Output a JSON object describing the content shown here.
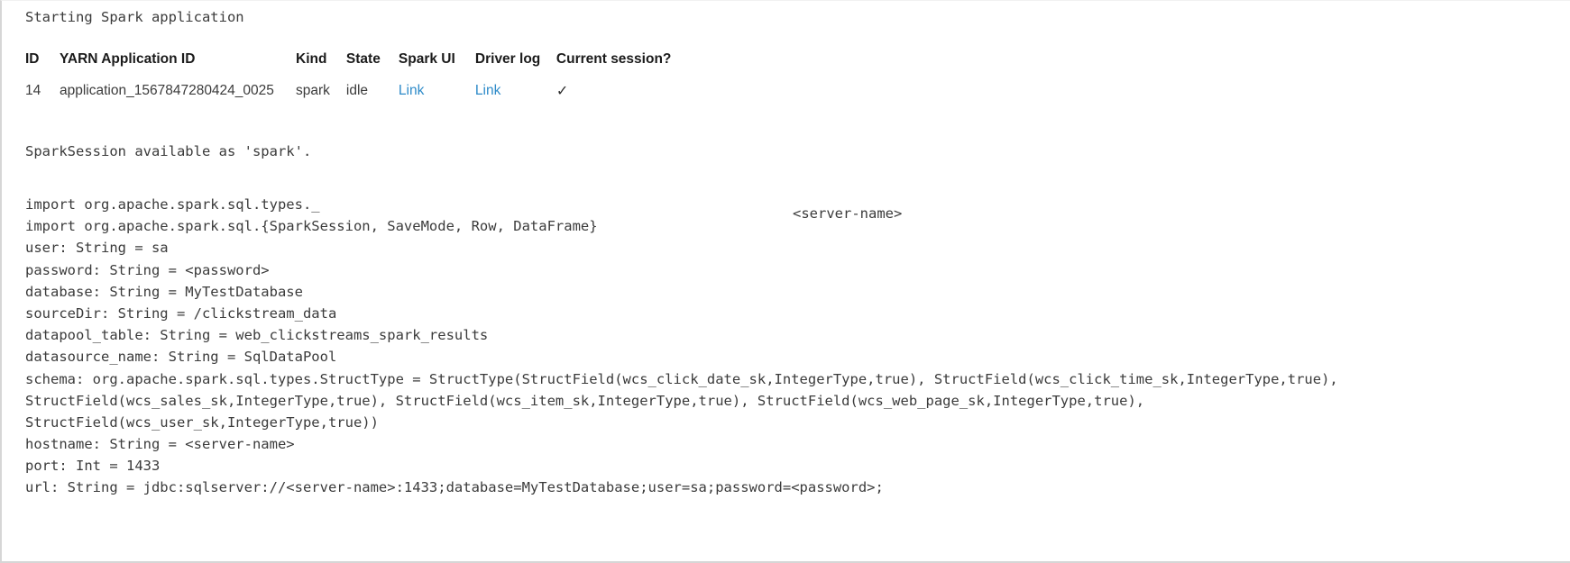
{
  "cell": {
    "status_line": "Starting Spark application"
  },
  "session_table": {
    "columns": [
      {
        "key": "id",
        "label": "ID"
      },
      {
        "key": "appid",
        "label": "YARN Application ID"
      },
      {
        "key": "kind",
        "label": "Kind"
      },
      {
        "key": "state",
        "label": "State"
      },
      {
        "key": "spark_ui",
        "label": "Spark UI"
      },
      {
        "key": "driver_log",
        "label": "Driver log"
      },
      {
        "key": "current",
        "label": "Current session?"
      }
    ],
    "rows": [
      {
        "id": "14",
        "appid": "application_1567847280424_0025",
        "kind": "spark",
        "state": "idle",
        "spark_ui": "Link",
        "driver_log": "Link",
        "current": "✓"
      }
    ],
    "link_color": "#2e8bc9"
  },
  "session_message": "SparkSession available as 'spark'.",
  "floating_annotation": "<server-name>",
  "repl_output": {
    "lines": [
      "import org.apache.spark.sql.types._",
      "import org.apache.spark.sql.{SparkSession, SaveMode, Row, DataFrame}",
      "user: String = sa",
      "password: String = <password>",
      "database: String = MyTestDatabase",
      "sourceDir: String = /clickstream_data",
      "datapool_table: String = web_clickstreams_spark_results",
      "datasource_name: String = SqlDataPool",
      "schema: org.apache.spark.sql.types.StructType = StructType(StructField(wcs_click_date_sk,IntegerType,true), StructField(wcs_click_time_sk,IntegerType,true),",
      "StructField(wcs_sales_sk,IntegerType,true), StructField(wcs_item_sk,IntegerType,true), StructField(wcs_web_page_sk,IntegerType,true),",
      "StructField(wcs_user_sk,IntegerType,true))",
      "hostname: String = <server-name>",
      "port: Int = 1433",
      "url: String = jdbc:sqlserver://<server-name>:1433;database=MyTestDatabase;user=sa;password=<password>;"
    ]
  }
}
